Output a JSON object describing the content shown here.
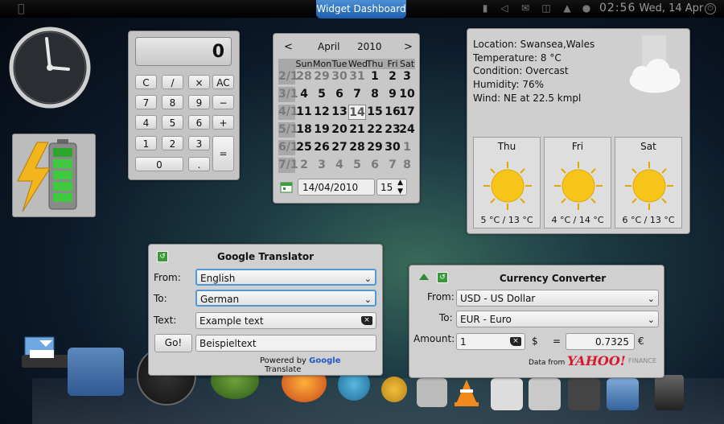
{
  "topbar": {
    "dashboard_tab": "Widget Dashboard",
    "time": "02:56",
    "date": "Wed, 14 Apr"
  },
  "calculator": {
    "display": "0",
    "keys": [
      "C",
      "/",
      "×",
      "AC",
      "7",
      "8",
      "9",
      "−",
      "4",
      "5",
      "6",
      "+",
      "1",
      "2",
      "3",
      "=",
      "0",
      "."
    ]
  },
  "calendar": {
    "prev": "<",
    "month": "April",
    "year": "2010",
    "next": ">",
    "day_headers": [
      "Sun",
      "Mon",
      "Tue",
      "Wed",
      "Thu",
      "Fri",
      "Sat"
    ],
    "weeks": [
      {
        "label": "2/1",
        "days": [
          "28",
          "29",
          "30",
          "31",
          "1",
          "2",
          "3"
        ]
      },
      {
        "label": "3/1",
        "days": [
          "4",
          "5",
          "6",
          "7",
          "8",
          "9",
          "10"
        ]
      },
      {
        "label": "4/1",
        "days": [
          "11",
          "12",
          "13",
          "14",
          "15",
          "16",
          "17"
        ]
      },
      {
        "label": "5/1",
        "days": [
          "18",
          "19",
          "20",
          "21",
          "22",
          "23",
          "24"
        ]
      },
      {
        "label": "6/1",
        "days": [
          "25",
          "26",
          "27",
          "28",
          "29",
          "30",
          "1"
        ]
      },
      {
        "label": "7/1",
        "days": [
          "2",
          "3",
          "4",
          "5",
          "6",
          "7",
          "8"
        ]
      }
    ],
    "date_field": "14/04/2010",
    "spin_value": "15"
  },
  "weather": {
    "location": "Location: Swansea,Wales",
    "temperature": "Temperature: 8 °C",
    "condition": "Condition: Overcast",
    "humidity": "Humidity: 76%",
    "wind": "Wind: NE at 22.5 kmpl",
    "forecast": [
      {
        "day": "Thu",
        "temps": "5 °C / 13 °C"
      },
      {
        "day": "Fri",
        "temps": "4 °C / 14 °C"
      },
      {
        "day": "Sat",
        "temps": "6 °C / 13 °C"
      }
    ]
  },
  "translator": {
    "title": "Google Translator",
    "from_label": "From:",
    "from_value": "English",
    "to_label": "To:",
    "to_value": "German",
    "text_label": "Text:",
    "text_value": "Example text",
    "go_button": "Go!",
    "result": "Beispieltext",
    "powered_by": "Powered by",
    "google": "Google",
    "translate": "Translate"
  },
  "currency": {
    "title": "Currency Converter",
    "from_label": "From:",
    "from_value": "USD - US Dollar",
    "to_label": "To:",
    "to_value": "EUR - Euro",
    "amount_label": "Amount:",
    "amount_value": "1",
    "from_symbol": "$",
    "equals": "=",
    "result_value": "0.7325",
    "to_symbol": "€",
    "data_from": "Data from",
    "yahoo": "YAHOO!",
    "finance": "FINANCE"
  },
  "colors": {
    "accent": "#1c5fae",
    "focus": "#4f9ad6",
    "battery_green": "#3ec93e",
    "bolt": "#f2b51c",
    "sun": "#f7c51a",
    "yahoo": "#d4192a"
  }
}
